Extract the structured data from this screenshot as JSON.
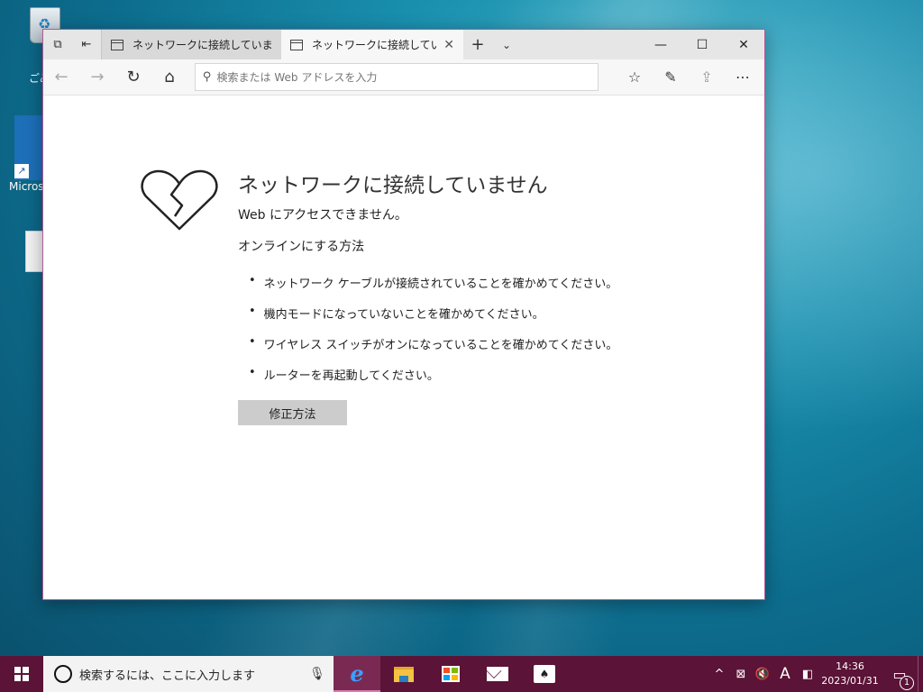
{
  "desktop": {
    "recycle_label": "ごみ",
    "edge_shortcut_label": "Micros"
  },
  "browser": {
    "tabs": [
      {
        "title": "ネットワークに接続していません",
        "active": false
      },
      {
        "title": "ネットワークに接続していま",
        "active": true
      }
    ],
    "address_placeholder": "検索または Web アドレスを入力",
    "window_controls": [
      "minimize",
      "maximize",
      "close"
    ]
  },
  "error_page": {
    "title": "ネットワークに接続していません",
    "subtitle": "Web にアクセスできません。",
    "how_heading": "オンラインにする方法",
    "tips": [
      "ネットワーク ケーブルが接続されていることを確かめてください。",
      "機内モードになっていないことを確かめてください。",
      "ワイヤレス スイッチがオンになっていることを確かめてください。",
      "ルーターを再起動してください。"
    ],
    "fix_button": "修正方法"
  },
  "taskbar": {
    "search_placeholder": "検索するには、ここに入力します",
    "ime_indicator": "A",
    "time": "14:36",
    "date": "2023/01/31",
    "notification_count": "1",
    "accent_color": "#5b1337"
  }
}
